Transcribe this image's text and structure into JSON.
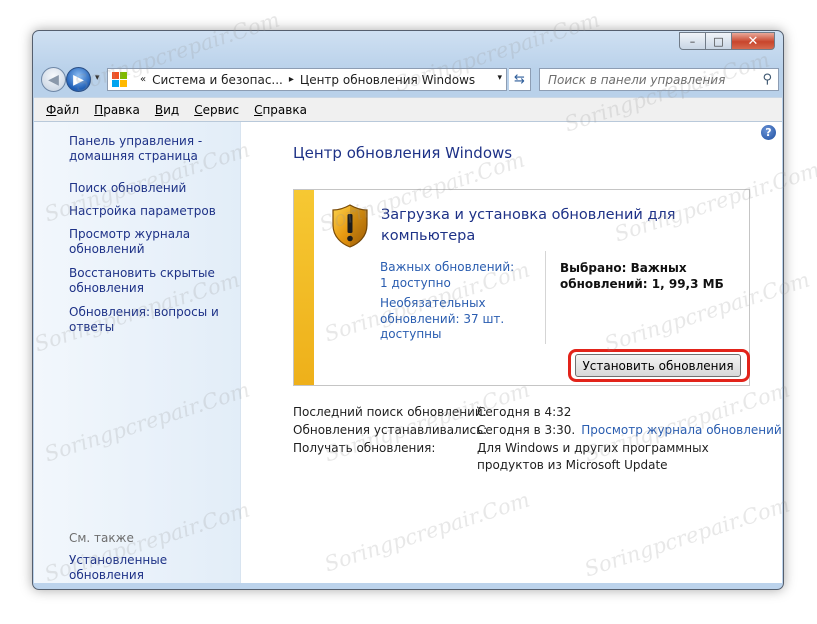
{
  "window": {
    "minimize_glyph": "–",
    "maximize_glyph": "□",
    "close_glyph": "✕"
  },
  "navbar": {
    "back_glyph": "◀",
    "forward_glyph": "▶",
    "address": {
      "breadcrumb_root_arrow": "«",
      "crumb1": "Система и безопас...",
      "crumb_separator": "▸",
      "crumb2": "Центр обновления Windows",
      "dropdown_glyph": "▾"
    },
    "refresh_glyph": "⇆",
    "search": {
      "placeholder": "Поиск в панели управления",
      "icon_glyph": "⚲"
    }
  },
  "menubar": {
    "file": "Файл",
    "edit": "Правка",
    "view": "Вид",
    "tools": "Сервис",
    "help": "Справка"
  },
  "sidebar": {
    "home": "Панель управления - домашняя страница",
    "check_updates": "Поиск обновлений",
    "settings": "Настройка параметров",
    "history": "Просмотр журнала обновлений",
    "restore_hidden": "Восстановить скрытые обновления",
    "faq": "Обновления: вопросы и ответы",
    "see_also": "См. также",
    "installed_updates": "Установленные обновления"
  },
  "main": {
    "help_glyph": "?",
    "page_title": "Центр обновления Windows",
    "status": {
      "title": "Загрузка и установка обновлений для компьютера",
      "important_link": "Важных обновлений: 1 доступно",
      "optional_link": "Необязательных обновлений: 37 шт. доступны",
      "selected": "Выбрано: Важных обновлений: 1, 99,3 МБ",
      "install_button": "Установить обновления"
    },
    "info": {
      "last_check_label": "Последний поиск обновлений:",
      "last_check_value": "Сегодня в 4:32",
      "installed_label": "Обновления устанавливались:",
      "installed_value": "Сегодня в 3:30.",
      "history_link": "Просмотр журнала обновлений",
      "receive_label": "Получать обновления:",
      "receive_value": "Для Windows и других программных продуктов из Microsoft Update"
    }
  },
  "watermark": "Soringpcrepair.Com",
  "colors": {
    "link_blue": "#1e3287",
    "status_yellow": "#f2bc24",
    "highlight_red": "#e2231a"
  }
}
